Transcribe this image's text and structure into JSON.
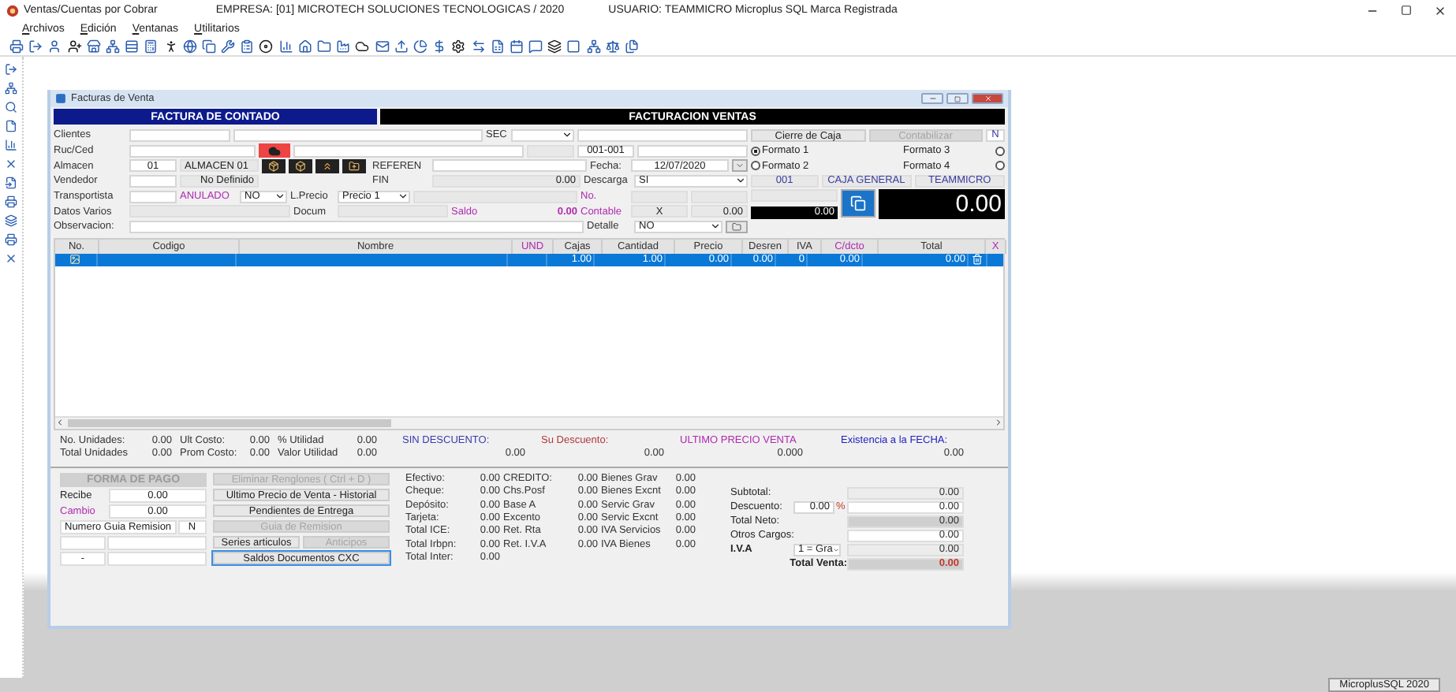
{
  "app": {
    "title": "Ventas/Cuentas por Cobrar",
    "empresa": "EMPRESA:  [01] MICROTECH SOLUCIONES TECNOLOGICAS / 2020",
    "usuario": "USUARIO: TEAMMICRO  Microplus SQL Marca Registrada"
  },
  "menu": [
    "Archivos",
    "Edición",
    "Ventanas",
    "Utilitarios"
  ],
  "child_window": {
    "title": "Facturas de Venta"
  },
  "banners": [
    {
      "text": "FACTURA DE CONTADO",
      "color": "#0c1a8c"
    },
    {
      "text": "FACTURACION VENTAS",
      "color": "#000000"
    }
  ],
  "form_rows": [
    [
      {
        "kind": "label",
        "text": "Clientes"
      },
      {
        "kind": "field"
      },
      {
        "kind": "field"
      },
      {
        "kind": "label",
        "text": "SEC"
      },
      {
        "kind": "select"
      },
      {
        "kind": "field"
      }
    ],
    [
      {
        "kind": "label",
        "text": "Ruc/Ced"
      },
      {
        "kind": "field"
      },
      {
        "kind": "cloud_button"
      },
      {
        "kind": "field"
      },
      {
        "kind": "display"
      },
      {
        "kind": "field",
        "value": "001-001"
      },
      {
        "kind": "field"
      }
    ],
    [
      {
        "kind": "label",
        "text": "Almacen"
      },
      {
        "kind": "field",
        "value": "01"
      },
      {
        "kind": "display",
        "value": "ALMACEN 01"
      },
      {
        "kind": "action_icons"
      },
      {
        "kind": "label",
        "text": "REFEREN"
      },
      {
        "kind": "field"
      },
      {
        "kind": "label",
        "text": "Fecha:"
      },
      {
        "kind": "field",
        "value": "12/07/2020"
      },
      {
        "kind": "picker"
      }
    ],
    [
      {
        "kind": "label",
        "text": "Vendedor"
      },
      {
        "kind": "field"
      },
      {
        "kind": "display",
        "value": "No Definido"
      },
      {
        "kind": "label",
        "text": "FIN"
      },
      {
        "kind": "display",
        "value": "0.00"
      },
      {
        "kind": "label",
        "text": "Descarga"
      },
      {
        "kind": "select",
        "value": "SI"
      }
    ],
    [
      {
        "kind": "label",
        "text": "Transportista"
      },
      {
        "kind": "field"
      },
      {
        "kind": "label",
        "text": "ANULADO",
        "color": "#b02ab0"
      },
      {
        "kind": "select",
        "value": "NO"
      },
      {
        "kind": "label",
        "text": "L.Precio"
      },
      {
        "kind": "select",
        "value": "Precio 1"
      },
      {
        "kind": "display"
      },
      {
        "kind": "label",
        "text": "No.",
        "color": "#b02ab0"
      },
      {
        "kind": "display"
      },
      {
        "kind": "display"
      }
    ],
    [
      {
        "kind": "label",
        "text": "Datos Varios"
      },
      {
        "kind": "display"
      },
      {
        "kind": "label",
        "text": "Docum"
      },
      {
        "kind": "display"
      },
      {
        "kind": "label",
        "text": "Saldo",
        "color": "#b02ab0"
      },
      {
        "kind": "value",
        "value": "0.00",
        "color": "#b02ab0"
      },
      {
        "kind": "label",
        "text": "Contable",
        "color": "#b02ab0"
      },
      {
        "kind": "display",
        "value": "X"
      },
      {
        "kind": "display",
        "value": "0.00"
      }
    ],
    [
      {
        "kind": "label",
        "text": "Observacion:"
      },
      {
        "kind": "field"
      },
      {
        "kind": "label",
        "text": "Detalle"
      },
      {
        "kind": "select",
        "value": "NO"
      },
      {
        "kind": "lookup"
      }
    ]
  ],
  "right_panel": {
    "buttons": [
      {
        "label": "Cierre de Caja",
        "disabled": false
      },
      {
        "label": "Contabilizar",
        "disabled": true
      }
    ],
    "flag": "N",
    "formats": [
      {
        "label": "Formato 1",
        "selected": true
      },
      {
        "label": "Formato 3",
        "selected": false
      },
      {
        "label": "Formato 2",
        "selected": false
      },
      {
        "label": "Formato 4",
        "selected": false
      }
    ],
    "caja": [
      "001",
      "CAJA GENERAL",
      "TEAMMICRO"
    ],
    "small_total": "0.00",
    "big_total": "0.00"
  },
  "grid": {
    "columns": [
      {
        "label": "No.",
        "color": "#333333"
      },
      {
        "label": "Codigo",
        "color": "#333333"
      },
      {
        "label": "Nombre",
        "color": "#333333"
      },
      {
        "label": "UND",
        "color": "#b02ab0"
      },
      {
        "label": "Cajas",
        "color": "#333333"
      },
      {
        "label": "Cantidad",
        "color": "#333333"
      },
      {
        "label": "Precio",
        "color": "#333333"
      },
      {
        "label": "Desren",
        "color": "#333333"
      },
      {
        "label": "IVA",
        "color": "#333333"
      },
      {
        "label": "C/dcto",
        "color": "#b02ab0"
      },
      {
        "label": "Total",
        "color": "#333333"
      },
      {
        "label": "X",
        "color": "#b02ab0"
      }
    ],
    "rows": [
      {
        "selected": true,
        "cells": [
          null,
          null,
          null,
          null,
          "1.00",
          "1.00",
          "0.00",
          "0.00",
          "0",
          "0.00",
          "0.00",
          null
        ]
      }
    ]
  },
  "stats": [
    [
      {
        "label": "No. Unidades:",
        "value": "0.00"
      },
      {
        "label": "Ult Costo:",
        "value": "0.00"
      },
      {
        "label": "% Utilidad",
        "value": "0.00"
      }
    ],
    [
      {
        "label": "Total Unidades",
        "value": "0.00"
      },
      {
        "label": "Prom Costo:",
        "value": "0.00"
      },
      {
        "label": "Valor Utilidad",
        "value": "0.00"
      }
    ]
  ],
  "indicators": [
    {
      "label": "SIN DESCUENTO:",
      "value": "0.00",
      "color": "#3a3ab0"
    },
    {
      "label": "Su Descuento:",
      "value": "0.00",
      "color": "#b03a3a"
    },
    {
      "label": "ULTIMO PRECIO VENTA",
      "value": "0.000",
      "color": "#b02ab0"
    },
    {
      "label": "Existencia a la FECHA:",
      "value": "0.00",
      "color": "#2020c0"
    }
  ],
  "payment": {
    "title": "FORMA DE PAGO",
    "rows": [
      {
        "label": "Recibe",
        "value": "0.00",
        "color": "#222222"
      },
      {
        "label": "Cambio",
        "value": "0.00",
        "color": "#b02ab0"
      }
    ],
    "guia": {
      "label": "Numero Guia Remision",
      "value": "N"
    },
    "remision_rows": [
      {},
      {
        "mark": "-"
      }
    ]
  },
  "actions": [
    [
      {
        "label": "Eliminar Renglones ( Ctrl + D )",
        "disabled": true,
        "focused": false
      }
    ],
    [
      {
        "label": "Ultimo Precio de Venta - Historial",
        "disabled": false,
        "focused": false
      }
    ],
    [
      {
        "label": "Pendientes de Entrega",
        "disabled": false,
        "focused": false
      }
    ],
    [
      {
        "label": "Guia de Remision",
        "disabled": true,
        "focused": false
      }
    ],
    [
      {
        "label": "Series articulos",
        "disabled": false,
        "focused": false
      },
      {
        "label": "Anticipos",
        "disabled": true,
        "focused": false
      }
    ],
    [
      {
        "label": "Saldos Documentos CXC",
        "disabled": false,
        "focused": true
      }
    ]
  ],
  "totals": [
    [
      {
        "label": "Efectivo:",
        "value": "0.00"
      },
      {
        "label": "Cheque:",
        "value": "0.00"
      },
      {
        "label": "Depósito:",
        "value": "0.00"
      },
      {
        "label": "Tarjeta:",
        "value": "0.00"
      },
      {
        "label": "Total ICE:",
        "value": "0.00"
      },
      {
        "label": "Total Irbpn:",
        "value": "0.00"
      },
      {
        "label": "Total Inter:",
        "value": "0.00"
      }
    ],
    [
      {
        "label": "CREDITO:",
        "value": "0.00"
      },
      {
        "label": "Chs.Posf",
        "value": "0.00"
      },
      {
        "label": "Base A",
        "value": "0.00"
      },
      {
        "label": "Excento",
        "value": "0.00"
      },
      {
        "label": "Ret. Rta",
        "value": "0.00"
      },
      {
        "label": "Ret. I.V.A",
        "value": "0.00"
      }
    ],
    [
      {
        "label": "Bienes Grav",
        "value": "0.00"
      },
      {
        "label": "Bienes Excnt",
        "value": "0.00"
      },
      {
        "label": "Servic Grav",
        "value": "0.00"
      },
      {
        "label": "Servic Excnt",
        "value": "0.00"
      },
      {
        "label": "IVA Servicios",
        "value": "0.00"
      },
      {
        "label": "IVA Bienes",
        "value": "0.00"
      }
    ]
  ],
  "summary_totals": [
    {
      "kind": "plain",
      "label": "Subtotal:",
      "value": "0.00"
    },
    {
      "kind": "discount",
      "label": "Descuento:",
      "input": "0.00",
      "unit": "%",
      "value": "0.00"
    },
    {
      "kind": "shaded",
      "label": "Total Neto:",
      "value": "0.00"
    },
    {
      "kind": "white",
      "label": "Otros Cargos:",
      "value": "0.00"
    },
    {
      "kind": "select",
      "label": "I.V.A",
      "option": "1 = Gra",
      "value": "0.00"
    },
    {
      "kind": "grand",
      "label": "Total Venta:",
      "value": "0.00"
    }
  ],
  "status_bar": "MicroplusSQL 2020"
}
